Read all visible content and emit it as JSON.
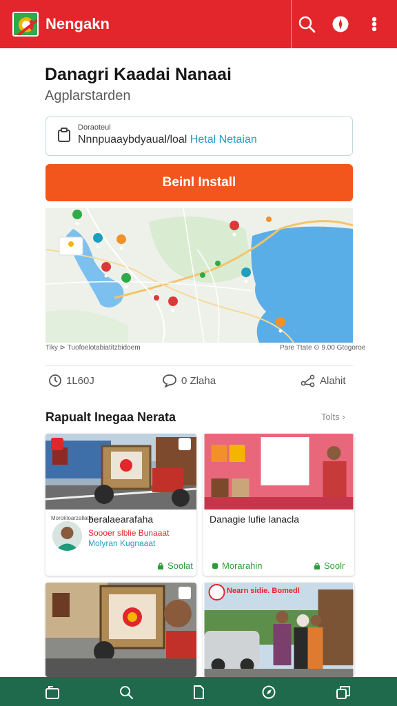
{
  "app": {
    "title": "Nengakn"
  },
  "toolbar": {
    "icons": [
      "search-icon",
      "info-icon",
      "more-vert-icon"
    ]
  },
  "header": {
    "headline": "Danagri Kaadai Nanaai",
    "subline": "Agplarstarden"
  },
  "info_box": {
    "label": "Doraoteul",
    "value": "Nnnpuaaybdyaual/loal",
    "highlight": "Hetal Netaian"
  },
  "cta": {
    "label": "Beinl Install"
  },
  "map": {
    "caption_left": "Tiky ⊳ Tuofoelotabiatitzbidoem",
    "caption_right": "Pare Ttate ⊙ 9.00 Gtogoroe"
  },
  "stats": [
    {
      "icon": "clock-icon",
      "value": "1L60J"
    },
    {
      "icon": "comment-icon",
      "value": "0 Zlaha"
    },
    {
      "icon": "share-icon",
      "value": "Alahit"
    }
  ],
  "section": {
    "title": "Rapualt Inegaa Nerata",
    "more": "Tolts"
  },
  "cards": [
    {
      "tag": "Moroktoarzallaizt",
      "title": "beralaearafaha",
      "line2": "Soooer slblie Bunaaat",
      "line3": "Molyran Kugnaaat",
      "footer": "Soolat"
    },
    {
      "title": "Danagie lufie lanacla",
      "footer_left": "Morarahin",
      "footer_right": "Soolr"
    },
    {
      "title": ""
    },
    {
      "photo_caption": "Nearn sidie. Bomedl"
    }
  ],
  "bottom_nav": [
    "home-icon",
    "search-icon",
    "document-icon",
    "explore-icon",
    "tabs-icon"
  ],
  "colors": {
    "brand": "#e2262b",
    "cta": "#f2561d",
    "accent": "#1e9ec0",
    "green": "#2a9d38",
    "nav": "#1f6a4d"
  }
}
